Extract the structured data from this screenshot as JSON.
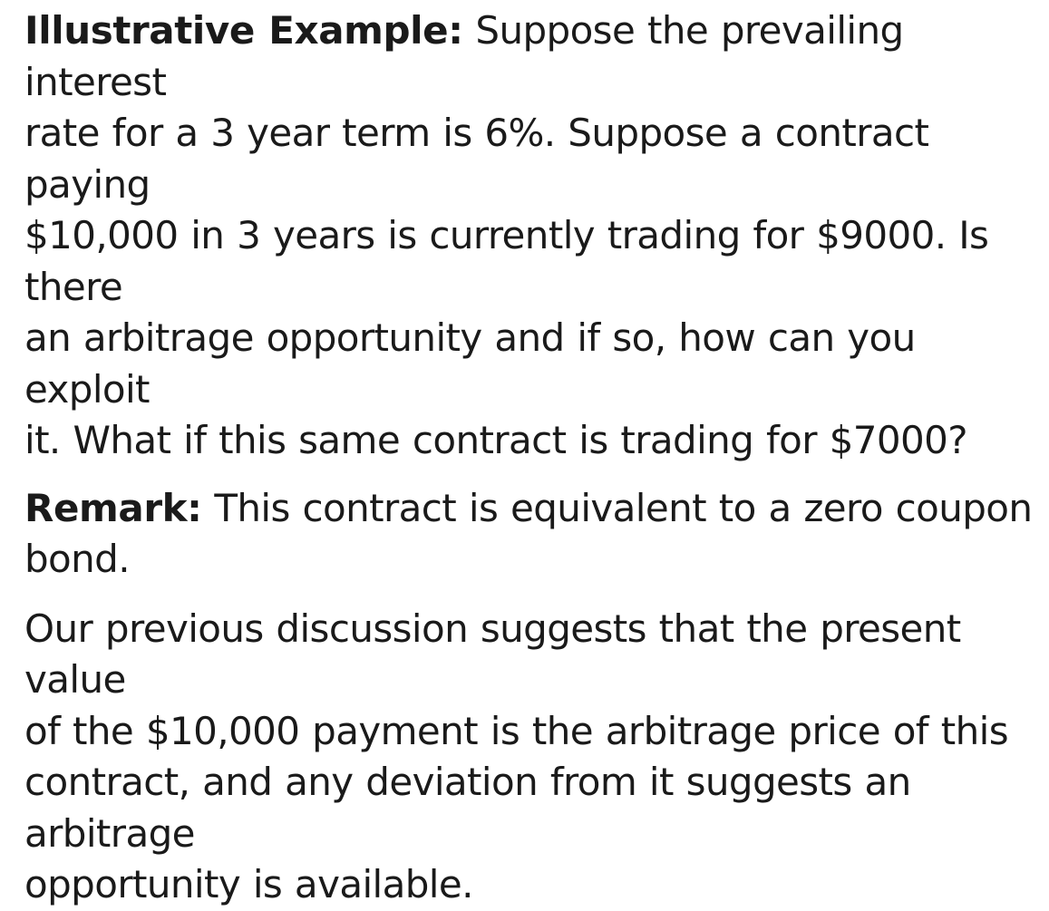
{
  "example": {
    "label": "Illustrative Example:",
    "lines": [
      " Suppose the prevailing interest",
      "rate for a 3 year term is 6%. Suppose a contract paying",
      "$10,000 in 3 years is currently trading for $9000. Is there",
      "an arbitrage opportunity and if so, how can you exploit",
      "it. What if this same contract is trading for $7000?"
    ]
  },
  "remark": {
    "label": "Remark:",
    "lines": [
      " This contract is equivalent to a zero coupon",
      "bond."
    ]
  },
  "discussion": {
    "lines": [
      "Our previous discussion suggests that the present value",
      "of the $10,000 payment is the arbitrage price of this",
      "contract, and any deviation from it suggests an arbitrage",
      "opportunity is available."
    ]
  }
}
